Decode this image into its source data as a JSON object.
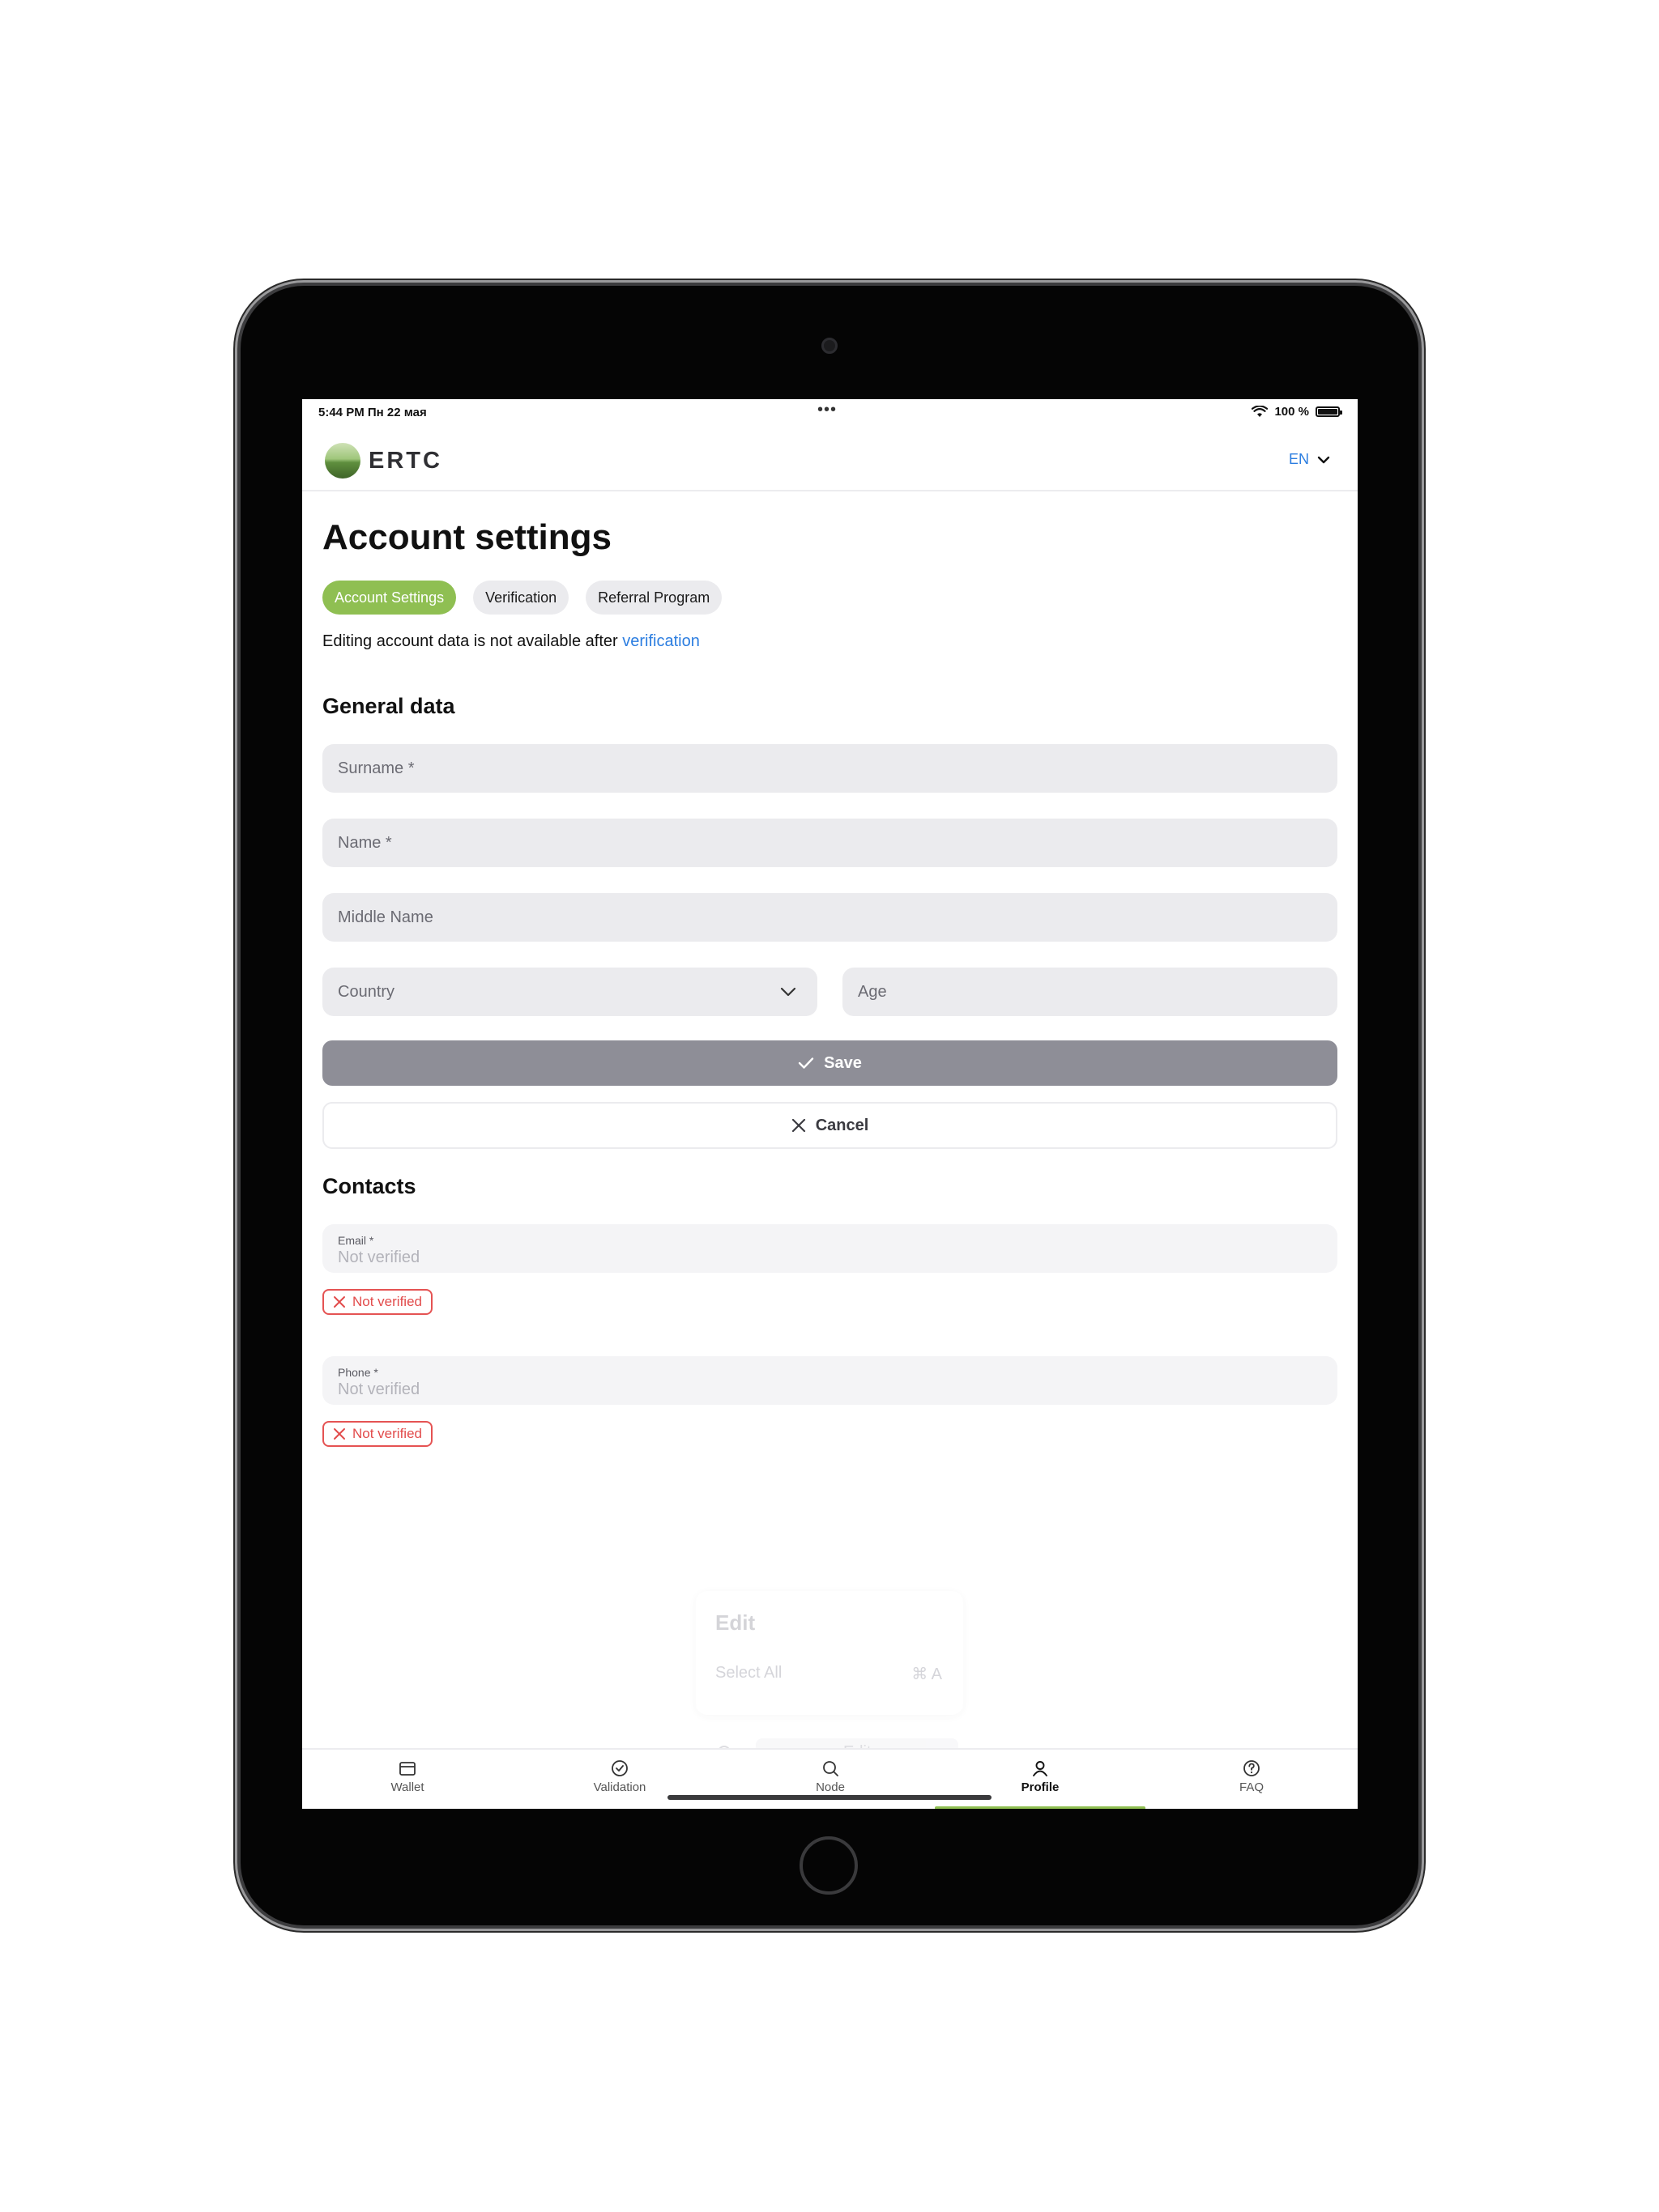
{
  "status_bar": {
    "time": "5:44 PM  Пн 22 мая",
    "dots": "•••",
    "battery_text": "100 %"
  },
  "header": {
    "logo_text": "ERTC",
    "language": "EN"
  },
  "page": {
    "title": "Account settings",
    "tabs": [
      {
        "label": "Account Settings",
        "active": true
      },
      {
        "label": "Verification",
        "active": false
      },
      {
        "label": "Referral Program",
        "active": false
      }
    ],
    "note_text": "Editing account data is not available after ",
    "note_link": "verification"
  },
  "general": {
    "heading": "General data",
    "surname_placeholder": "Surname *",
    "name_placeholder": "Name *",
    "middle_placeholder": "Middle Name",
    "country_placeholder": "Country",
    "age_placeholder": "Age",
    "save_label": "Save",
    "cancel_label": "Cancel"
  },
  "contacts": {
    "heading": "Contacts",
    "email_label": "Email *",
    "email_value": "Not verified",
    "email_badge": "Not verified",
    "phone_label": "Phone *",
    "phone_value": "Not verified",
    "phone_badge": "Not verified"
  },
  "edit_menu": {
    "title": "Edit",
    "item": "Select All",
    "shortcut": "⌘ A",
    "search_text": "Edit"
  },
  "tabbar": {
    "items": [
      {
        "label": "Wallet",
        "icon": "wallet-icon",
        "active": false
      },
      {
        "label": "Validation",
        "icon": "check-circle-icon",
        "active": false
      },
      {
        "label": "Node",
        "icon": "search-icon",
        "active": false
      },
      {
        "label": "Profile",
        "icon": "user-icon",
        "active": true
      },
      {
        "label": "FAQ",
        "icon": "question-circle-icon",
        "active": false
      }
    ]
  },
  "colors": {
    "accent_green": "#8fbf52",
    "link_blue": "#2b7de0",
    "error_red": "#e24b4b",
    "save_gray": "#8e8e97"
  }
}
